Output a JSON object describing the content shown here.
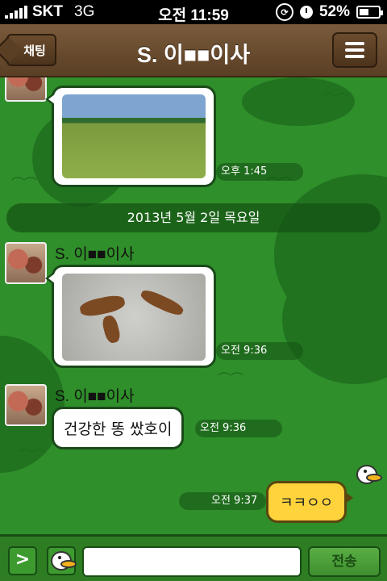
{
  "status_bar": {
    "carrier": "SKT",
    "network": "3G",
    "time": "오전 11:59",
    "battery": "52%"
  },
  "header": {
    "back_label": "채팅",
    "title": "S. 이■■이사"
  },
  "messages": [
    {
      "type": "image",
      "sender": "",
      "time": "오후 1:45"
    },
    {
      "type": "date",
      "text": "2013년 5월 2일 목요일"
    },
    {
      "type": "image",
      "sender": "S. 이■■이사",
      "time": "오전 9:36"
    },
    {
      "type": "text",
      "sender": "S. 이■■이사",
      "text": "건강한 똥 쌌호이",
      "time": "오전 9:36"
    },
    {
      "type": "mine",
      "text": "ㅋㅋㅇㅇ",
      "time": "오전 9:37"
    }
  ],
  "input_bar": {
    "expand_label": ">",
    "send_label": "전송",
    "message_value": ""
  },
  "colors": {
    "background": "#2f8f2a",
    "header": "#6b4c2e",
    "my_bubble": "#ffd33b"
  }
}
